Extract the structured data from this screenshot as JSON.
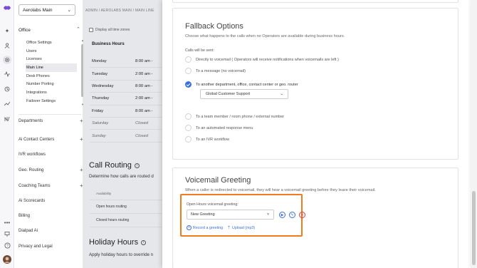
{
  "rail": {
    "icons": [
      "logo-icon",
      "sparkle-icon",
      "person-icon",
      "settings-icon",
      "activity-icon",
      "history-icon",
      "trend-icon",
      "ai-icon",
      "dots-icon",
      "monitor-icon",
      "help-icon",
      "avatar"
    ]
  },
  "sidebar": {
    "account": "Aerolabs Main",
    "office_label": "Office",
    "office_items": [
      {
        "label": "Office Settings"
      },
      {
        "label": "Users"
      },
      {
        "label": "Licenses"
      },
      {
        "label": "Main Line",
        "active": true
      },
      {
        "label": "Desk Phones"
      },
      {
        "label": "Number Porting"
      },
      {
        "label": "Integrations"
      },
      {
        "label": "Failover Settings"
      }
    ],
    "sections": [
      {
        "label": "Departments",
        "plus": true
      },
      {
        "label": "Ai Contact Centers",
        "plus": true
      },
      {
        "label": "IVR workflows",
        "plus": false
      },
      {
        "label": "Geo. Routing",
        "plus": true
      },
      {
        "label": "Coaching Teams",
        "plus": true
      },
      {
        "label": "Ai Scorecards",
        "plus": false
      },
      {
        "label": "Billing",
        "plus": false
      },
      {
        "label": "Dialpad Ai",
        "plus": false
      },
      {
        "label": "Privacy and Legal",
        "plus": false
      }
    ]
  },
  "middle": {
    "breadcrumb": "ADMIN / AEROLABS MAIN / MAIN LINE",
    "display_all_timezones": "Display all time zones",
    "business_hours_title": "Business Hours",
    "days": [
      {
        "day": "Monday",
        "time": "8:00 am -"
      },
      {
        "day": "Tuesday",
        "time": "2:00 am -"
      },
      {
        "day": "Wednesday",
        "time": "8:00 am -"
      },
      {
        "day": "Thursday",
        "time": "2:00 am -"
      },
      {
        "day": "Friday",
        "time": "8:00 am -"
      },
      {
        "day": "Saturday",
        "time": "Closed",
        "closed": true
      },
      {
        "day": "Sunday",
        "time": "Closed",
        "closed": true
      }
    ],
    "call_routing_title": "Call Routing",
    "call_routing_desc": "Determine how calls are routed d",
    "routing_header": "Availability",
    "routing_rows": [
      "Open hours routing",
      "Closed hours routing"
    ],
    "holiday_title": "Holiday Hours",
    "holiday_desc": "Apply holiday hours to override n"
  },
  "fallback": {
    "title": "Fallback Options",
    "desc": "Choose what happens to the calls when no Operators are available during business hours.",
    "calls_sent_label": "Calls will be sent:",
    "options": [
      {
        "label": "Directly to voicemail ( Operators will receive notifications when voicemails are left )",
        "selected": false
      },
      {
        "label": "To a message (no voicemail)",
        "selected": false
      },
      {
        "label": "To another department, office, contact center or geo. router",
        "selected": true
      },
      {
        "label": "To a team member / room phone / external number",
        "selected": false
      },
      {
        "label": "To an automated response menu",
        "selected": false
      },
      {
        "label": "To an IVR workflow",
        "selected": false
      }
    ],
    "target_select": "Global Customer Support"
  },
  "voicemail": {
    "title": "Voicemail Greeting",
    "desc": "When a caller is redirected to voicemail, they will hear a voicemail greeting before they leave their voicemail.",
    "open_hours_label": "Open Hours voicemail greeting:",
    "greeting_select": "New Greeting",
    "record_link": "Record a greeting",
    "upload_link": "Upload (mp3)"
  },
  "colors": {
    "accent": "#3b6fd9",
    "highlight": "#f27b1f",
    "danger": "#e0393e"
  }
}
